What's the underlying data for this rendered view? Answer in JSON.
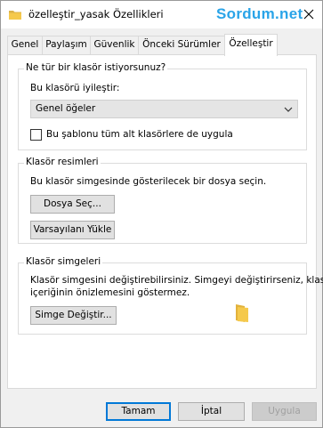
{
  "window": {
    "title": "özelleştir_yasak Özellikleri",
    "close_icon": "close-icon"
  },
  "watermark": "Sordum.net",
  "tabs": [
    {
      "label": "Genel",
      "active": false
    },
    {
      "label": "Paylaşım",
      "active": false
    },
    {
      "label": "Güvenlik",
      "active": false
    },
    {
      "label": "Önceki Sürümler",
      "active": false
    },
    {
      "label": "Özelleştir",
      "active": true
    }
  ],
  "folder_type": {
    "heading": "Ne tür bir klasör istiyorsunuz?",
    "optimize_label": "Bu klasörü iyileştir:",
    "selected": "Genel öğeler",
    "apply_subfolders_label": "Bu şablonu tüm alt klasörlere de uygula",
    "apply_subfolders_checked": false
  },
  "folder_pictures": {
    "heading": "Klasör resimleri",
    "description": "Bu klasör simgesinde gösterilecek bir dosya seçin.",
    "choose_file_label": "Dosya Seç...",
    "restore_default_label": "Varsayılanı Yükle"
  },
  "folder_icons": {
    "heading": "Klasör simgeleri",
    "description_line1": "Klasör simgesini değiştirebilirsiniz. Simgeyi değiştirirseniz, klasör",
    "description_line2": "içeriğinin önizlemesini göstermez.",
    "change_icon_label": "Simge Değiştir...",
    "preview_icon": "folder-icon"
  },
  "footer": {
    "ok_label": "Tamam",
    "cancel_label": "İptal",
    "apply_label": "Uygula",
    "apply_enabled": false
  },
  "colors": {
    "watermark": "#2aa4e8",
    "default_button_border": "#0078d7",
    "folder_yellow": "#f5c94c"
  }
}
